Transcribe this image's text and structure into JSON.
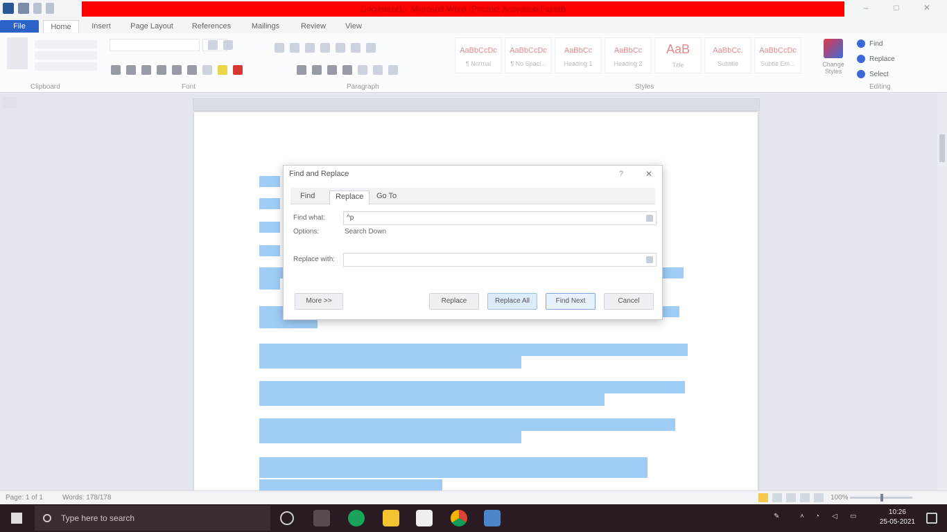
{
  "window": {
    "title": "Document1 - Microsoft Word (Product Activation Failed)",
    "controls": [
      "–",
      "□",
      "✕"
    ]
  },
  "ribbon_tabs": [
    "File",
    "Home",
    "Insert",
    "Page Layout",
    "References",
    "Mailings",
    "Review",
    "View"
  ],
  "ribbon": {
    "clipboard": {
      "paste": "Paste",
      "cut": "Cut",
      "copy": "Copy",
      "format_painter": "Format Painter",
      "group": "Clipboard"
    },
    "font": {
      "name": "",
      "size": "",
      "group": "Font"
    },
    "paragraph_group": "Paragraph",
    "styles": [
      {
        "sample": "AaBbCcDc",
        "name": "¶ Normal"
      },
      {
        "sample": "AaBbCcDc",
        "name": "¶ No Spaci..."
      },
      {
        "sample": "AaBbCc",
        "name": "Heading 1"
      },
      {
        "sample": "AaBbCc",
        "name": "Heading 2"
      },
      {
        "sample": "AaB",
        "name": "Title"
      },
      {
        "sample": "AaBbCc.",
        "name": "Subtitle"
      },
      {
        "sample": "AaBbCcDc",
        "name": "Subtle Em..."
      }
    ],
    "styles_group": "Styles",
    "change_styles": "Change Styles",
    "editing": {
      "find": "Find",
      "replace": "Replace",
      "select": "Select",
      "group": "Editing"
    }
  },
  "dialog": {
    "title": "Find and Replace",
    "help": "?",
    "close": "✕",
    "tabs": [
      "Find",
      "Replace",
      "Go To"
    ],
    "active_tab": 1,
    "find_what_label": "Find what:",
    "find_what_value": "^p",
    "options_label": "Options:",
    "options_value": "Search Down",
    "replace_with_label": "Replace with:",
    "replace_with_value": "",
    "buttons": {
      "more": "More >>",
      "replace": "Replace",
      "replace_all": "Replace All",
      "find_next": "Find Next",
      "cancel": "Cancel"
    }
  },
  "document": {
    "paragraphs": [
      "",
      "",
      "",
      "",
      ""
    ]
  },
  "statusbar": {
    "page": "Page: 1 of 1",
    "words": "Words: 178/178",
    "zoom": "100%"
  },
  "taskbar": {
    "search_placeholder": "Type here to search",
    "time": "10:26",
    "date": "25-05-2021"
  }
}
